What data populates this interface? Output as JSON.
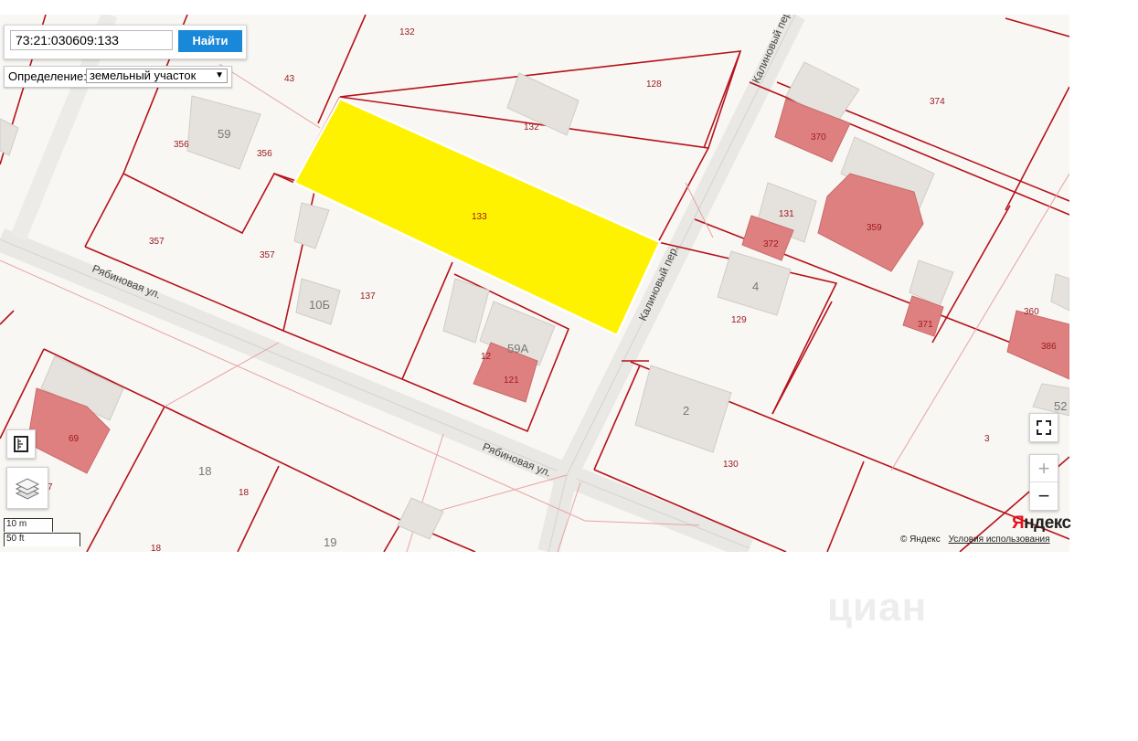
{
  "search": {
    "value": "73:21:030609:133",
    "button_label": "Найти"
  },
  "definition": {
    "label": "Определение:",
    "selected": "земельный участок"
  },
  "map": {
    "street_labels": [
      "Рябиновая ул.",
      "Рябиновая ул.",
      "Калиновый пер.",
      "Калиновый пер."
    ],
    "parcel_labels": [
      "132",
      "128",
      "43",
      "356",
      "356",
      "132",
      "374",
      "133",
      "370",
      "131",
      "359",
      "357",
      "357",
      "372",
      "129",
      "137",
      "371",
      "360",
      "386",
      "12",
      "121",
      "69",
      "3",
      "18",
      "18",
      "130",
      "7",
      "19",
      "18"
    ],
    "building_labels": [
      "59",
      "10Б",
      "59А",
      "4",
      "2",
      "52"
    ],
    "selected_parcel": "133",
    "selected_color": "#fff200"
  },
  "scale": {
    "metric": "10 m",
    "imperial": "50 ft"
  },
  "attribution": {
    "copyright": "© Яндекс",
    "terms": "Условия использования",
    "logo": "Яндекс"
  },
  "watermark": "циан",
  "controls": {
    "zoom_in": "+",
    "zoom_out": "−"
  }
}
